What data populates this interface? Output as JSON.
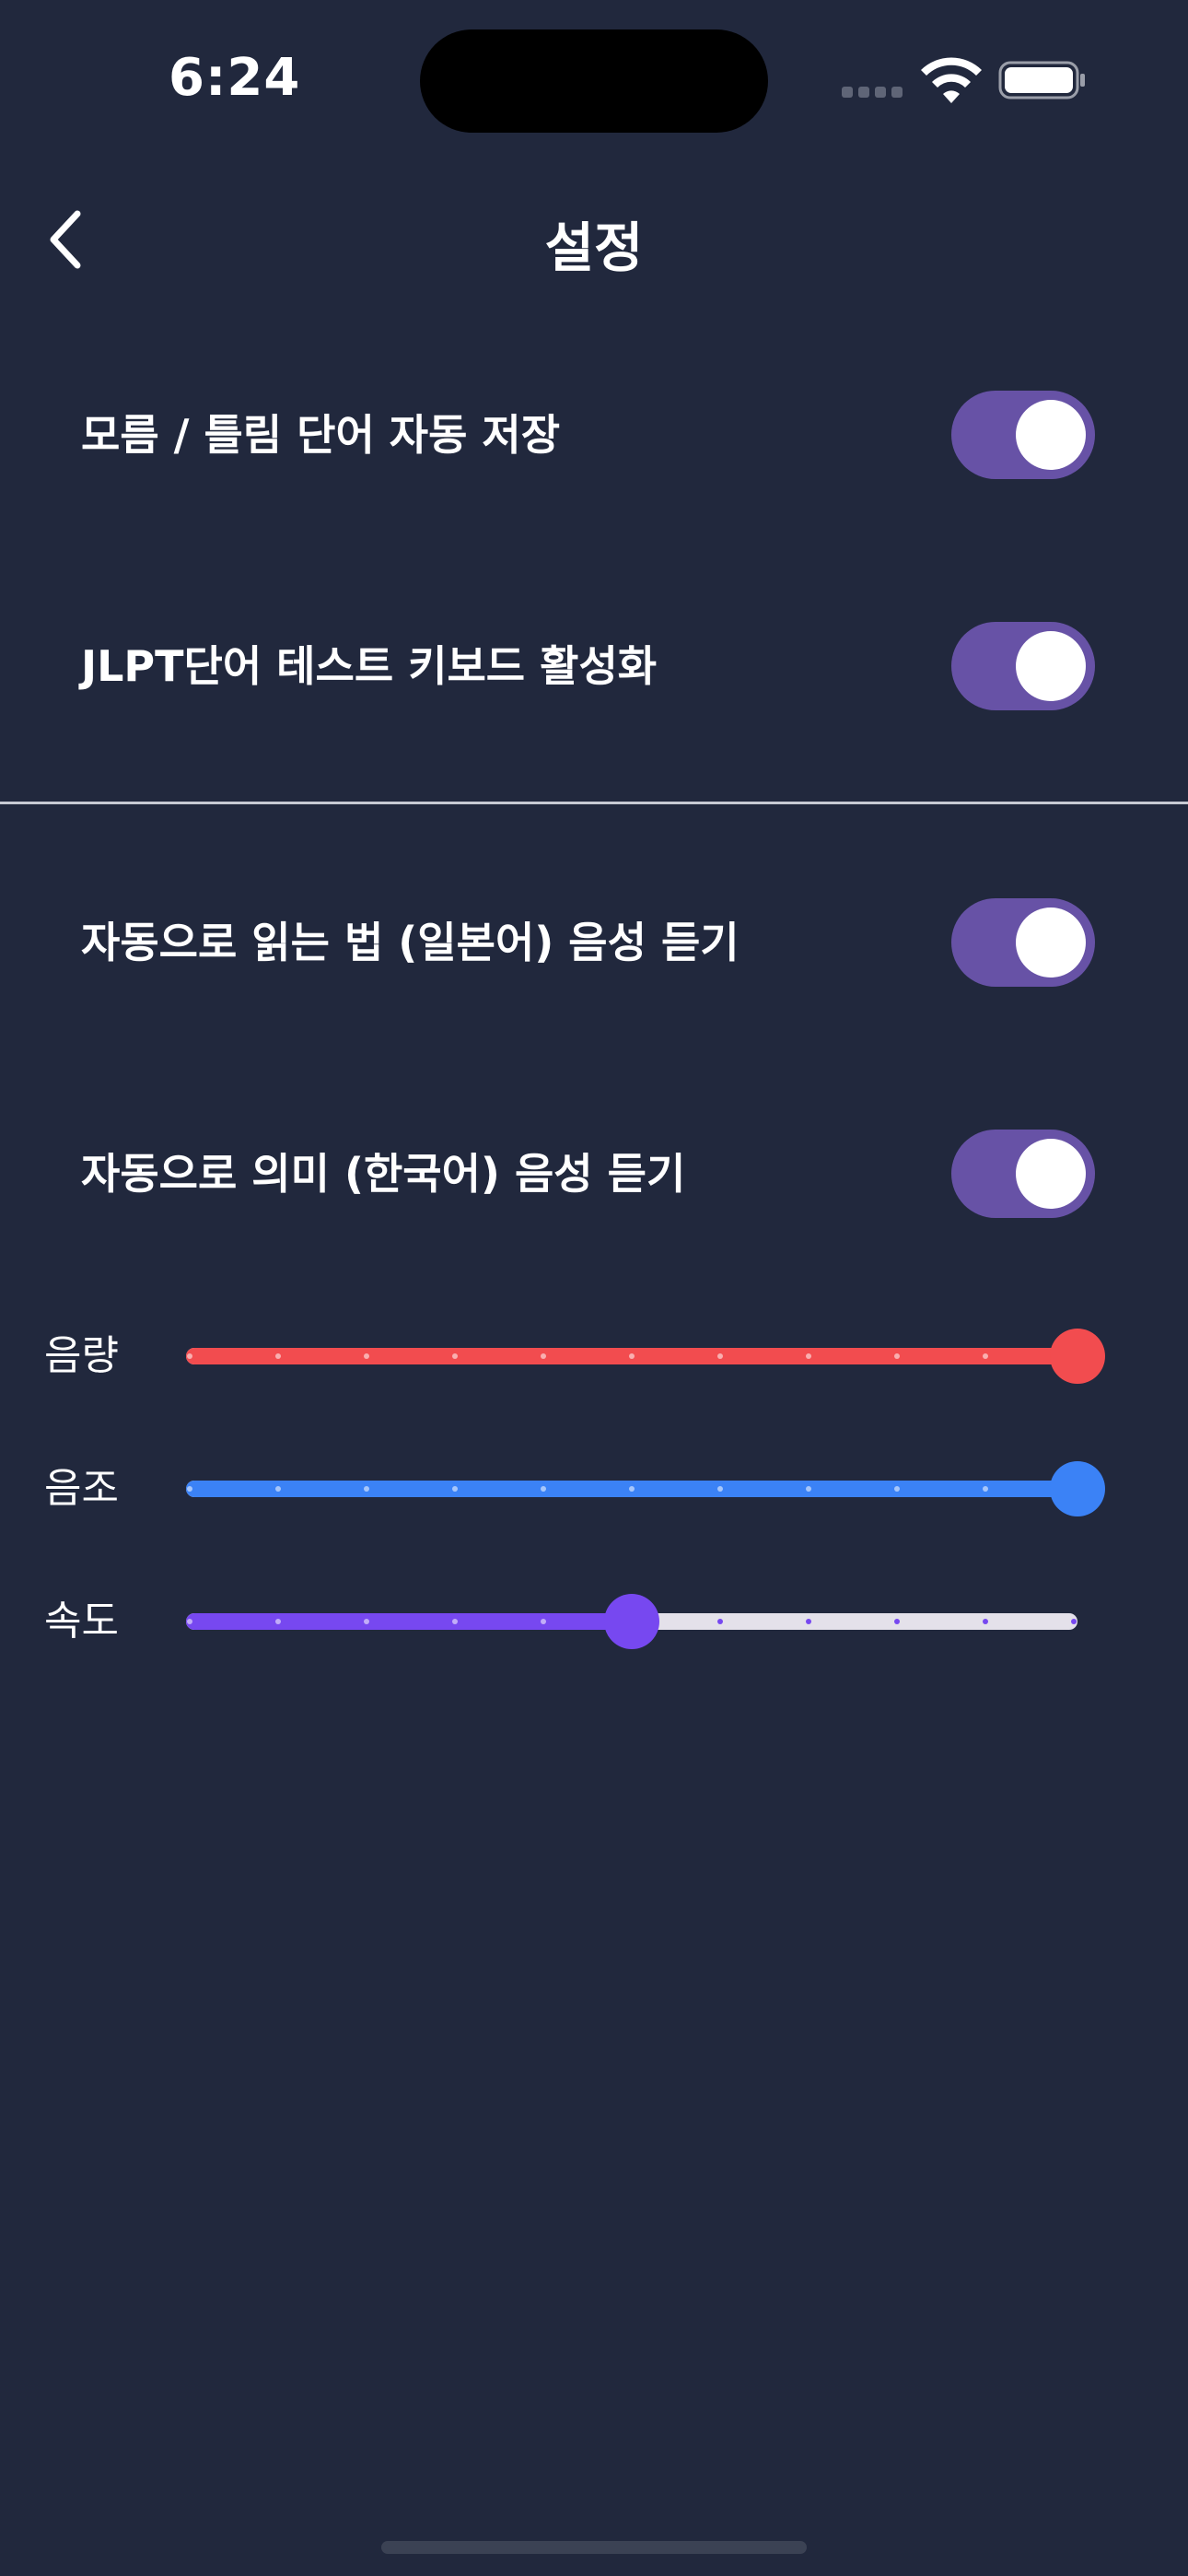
{
  "status_bar": {
    "time": "6:24"
  },
  "nav": {
    "title": "설정",
    "back_icon": "chevron-left-icon"
  },
  "settings": {
    "toggles": [
      {
        "label": "모름 / 틀림 단어 자동 저장",
        "on": true
      },
      {
        "label": "JLPT단어 테스트 키보드 활성화",
        "on": true
      },
      {
        "label": "자동으로 읽는 법 (일본어) 음성 듣기",
        "on": true
      },
      {
        "label": "자동으로 의미 (한국어) 음성 듣기",
        "on": true
      }
    ],
    "toggle_color": "#6752a6",
    "sliders": [
      {
        "label": "음량",
        "value": 1.0,
        "color": "#f24c4f"
      },
      {
        "label": "음조",
        "value": 1.0,
        "color": "#3b82f6"
      },
      {
        "label": "속도",
        "value": 0.5,
        "color": "#7748f0"
      }
    ],
    "slider_track_color": "#e4e1ea"
  },
  "colors": {
    "background": "#21283d"
  }
}
